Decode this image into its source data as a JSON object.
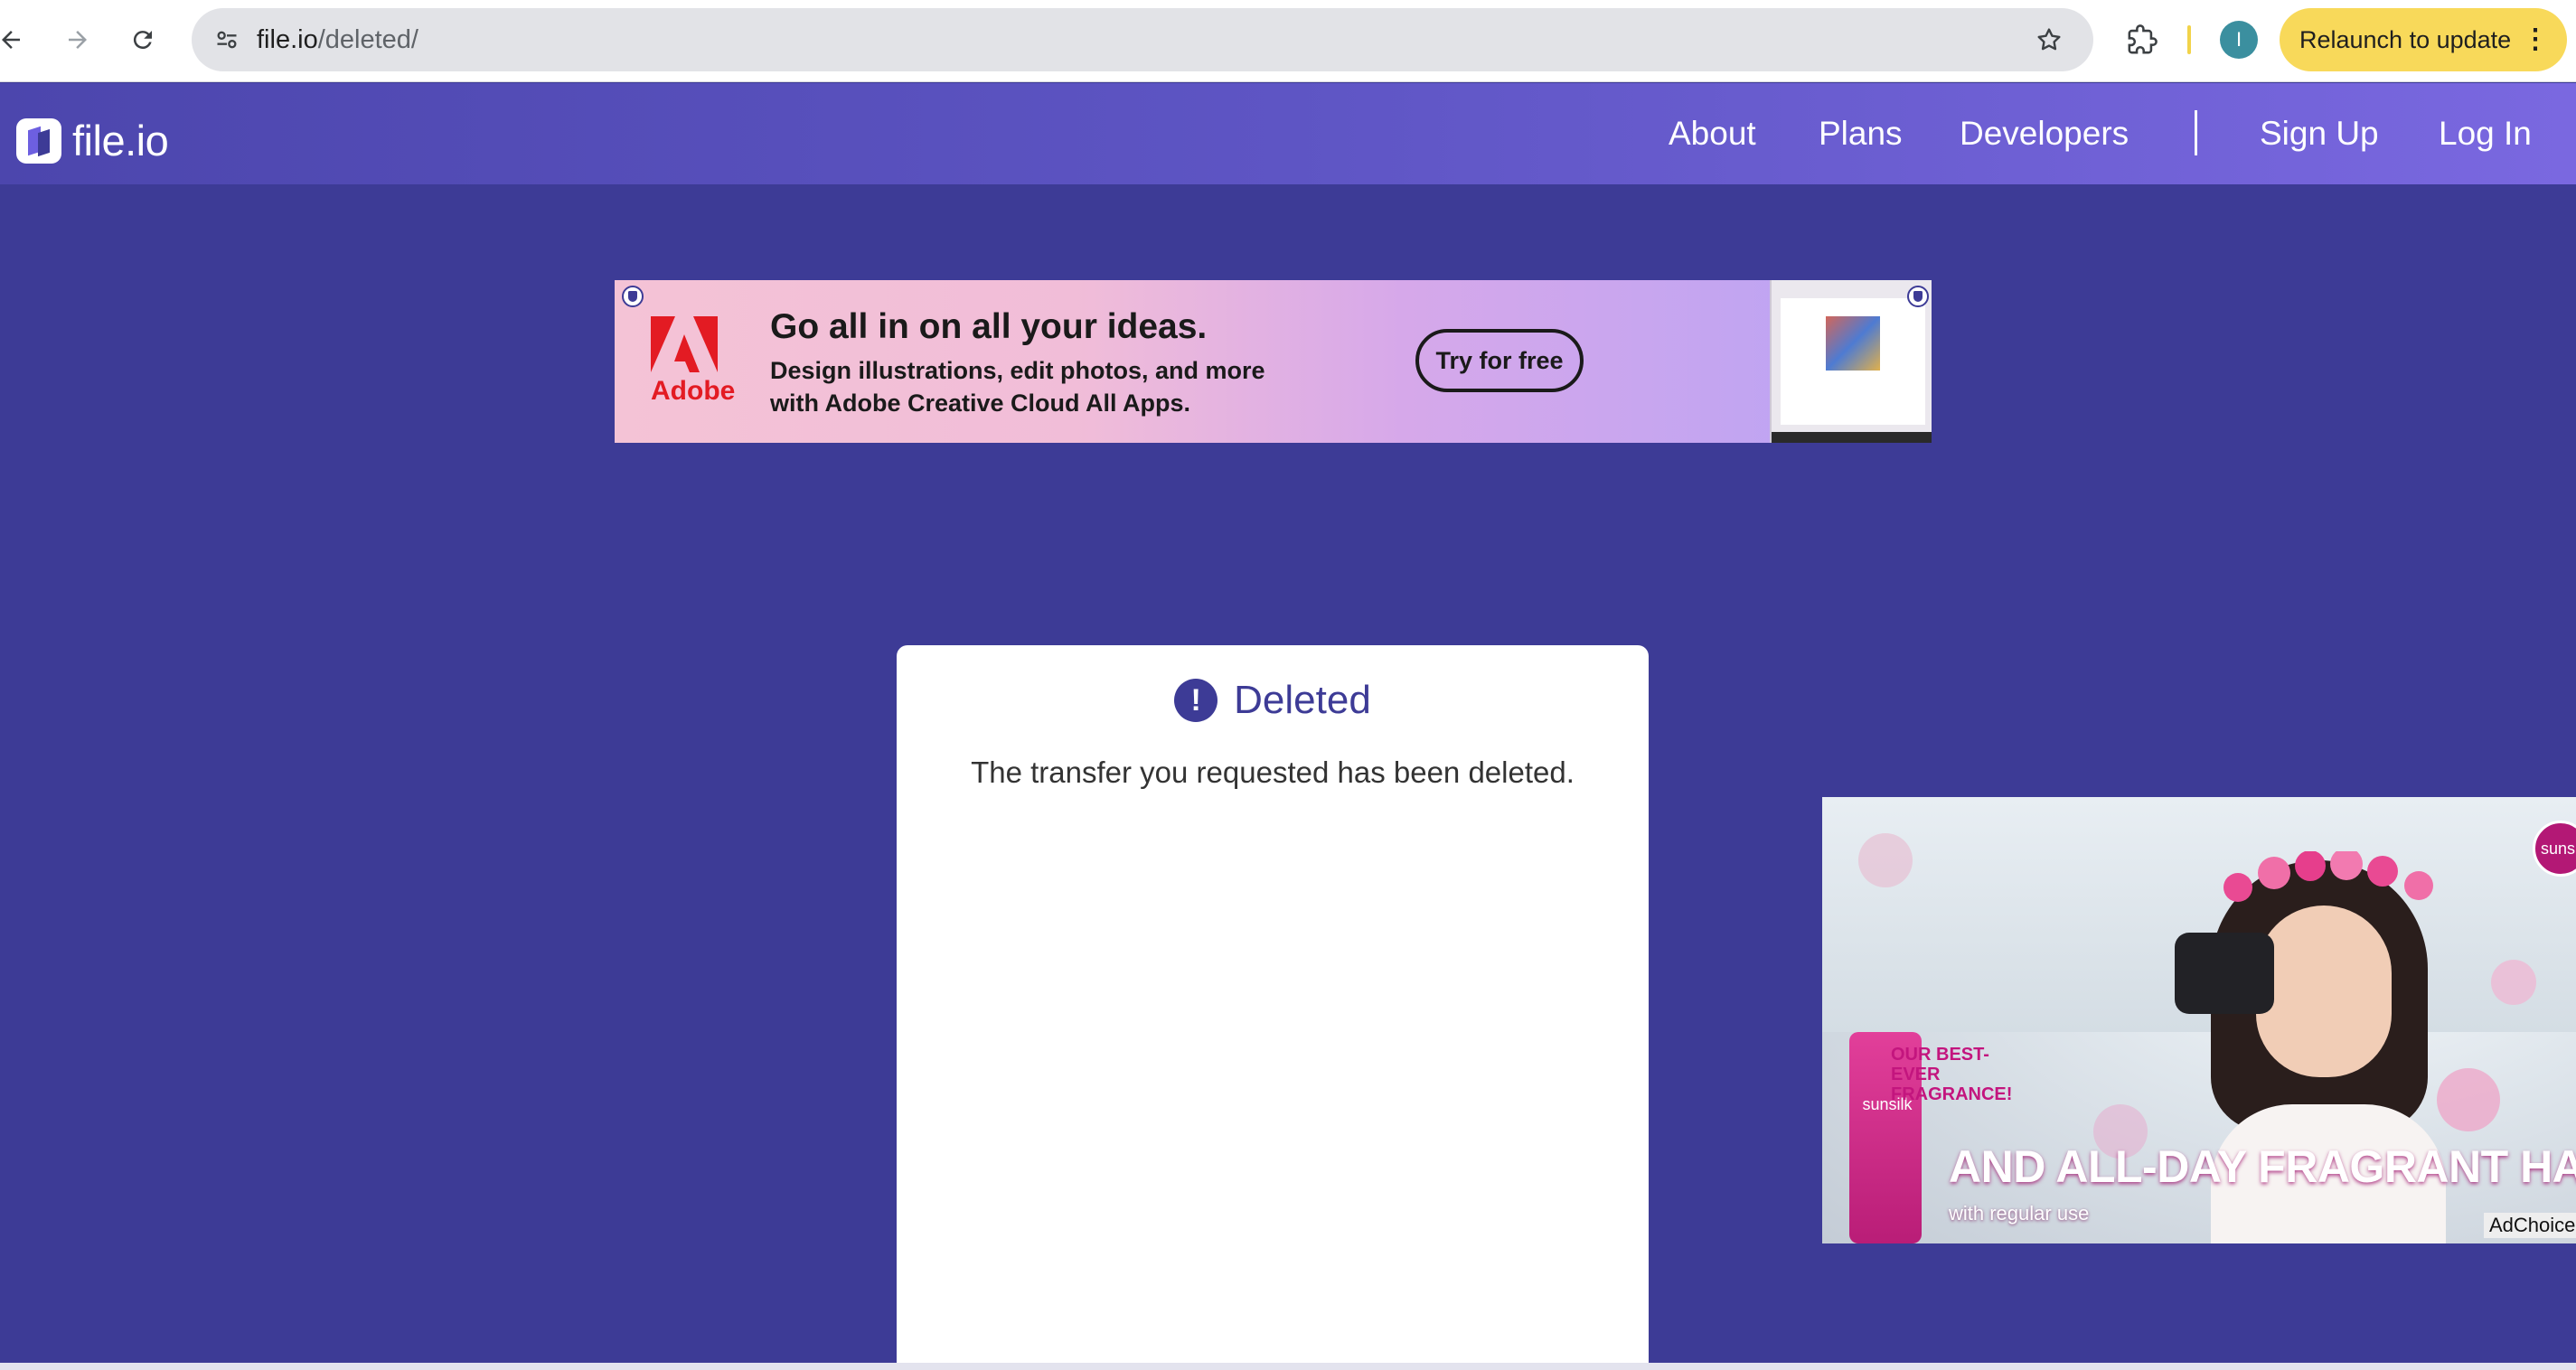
{
  "browser": {
    "back_icon": "arrow-left-icon",
    "forward_icon": "arrow-right-icon",
    "reload_icon": "reload-icon",
    "url_host": "file.io",
    "url_path": "/deleted/",
    "bookmark_icon": "star-icon",
    "extensions_icon": "puzzle-icon",
    "profile_initial": "I",
    "relaunch_label": "Relaunch to update",
    "menu_glyph": "⋮"
  },
  "header": {
    "logo_text": "file.io",
    "nav": [
      {
        "label": "About"
      },
      {
        "label": "Plans"
      },
      {
        "label": "Developers"
      },
      {
        "label": "Sign Up"
      },
      {
        "label": "Log In"
      }
    ]
  },
  "banner_ad": {
    "brand": "Adobe",
    "headline": "Go all in on all your ideas.",
    "sub_line1": "Design illustrations, edit photos, and more",
    "sub_line2": "with Adobe Creative Cloud All Apps.",
    "cta": "Try for free"
  },
  "card": {
    "icon": "exclamation-circle-icon",
    "icon_glyph": "!",
    "title": "Deleted",
    "message": "The transfer you requested has been deleted."
  },
  "video_ad": {
    "brand_badge": "sunsilk",
    "promo_headline": "OUR BEST-EVER FRAGRANCE!",
    "bottle_label": "sunsilk",
    "headline": "AND ALL-DAY FRAGRANT HAIR",
    "subline": "with regular use",
    "adchoices": "AdChoices"
  },
  "colors": {
    "page_bg": "#3d3b96",
    "accent": "#3d3b96",
    "relaunch_bg": "#f8d95a"
  }
}
